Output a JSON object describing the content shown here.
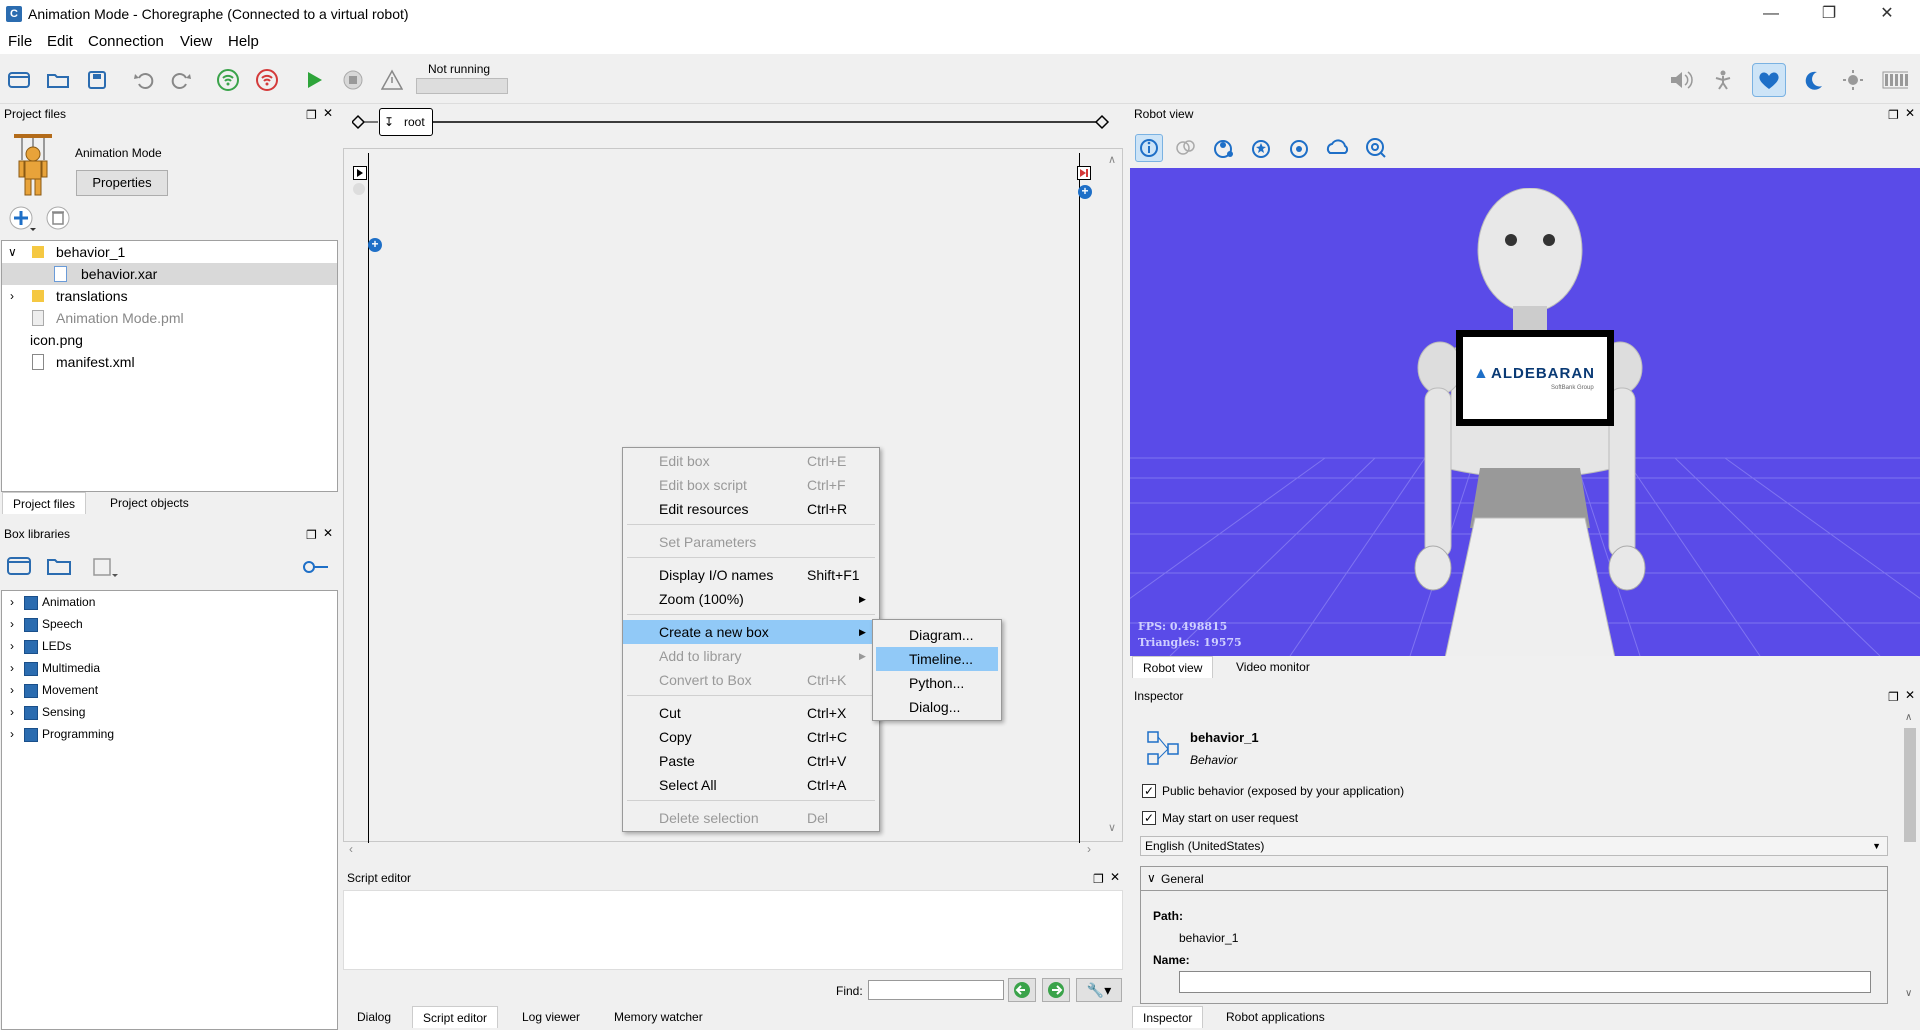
{
  "window": {
    "title": "Animation Mode - Choregraphe (Connected to a virtual robot)",
    "app_icon": "C"
  },
  "menu": [
    "File",
    "Edit",
    "Connection",
    "View",
    "Help"
  ],
  "toolbar": {
    "status": "Not running"
  },
  "project_files": {
    "title": "Project files",
    "project_name": "Animation Mode",
    "properties_label": "Properties",
    "tree": [
      {
        "label": "behavior_1",
        "type": "folder",
        "expanded": true,
        "indent": 0
      },
      {
        "label": "behavior.xar",
        "type": "file",
        "selected": true,
        "indent": 1
      },
      {
        "label": "translations",
        "type": "folder",
        "expanded": false,
        "indent": 0
      },
      {
        "label": "Animation Mode.pml",
        "type": "pml",
        "dim": true,
        "indent": 0
      },
      {
        "label": "icon.png",
        "type": "plain",
        "indent": 0
      },
      {
        "label": "manifest.xml",
        "type": "file",
        "indent": 0
      }
    ],
    "tabs": [
      "Project files",
      "Project objects"
    ]
  },
  "box_libraries": {
    "title": "Box libraries",
    "items": [
      "Animation",
      "Speech",
      "LEDs",
      "Multimedia",
      "Movement",
      "Sensing",
      "Programming"
    ]
  },
  "flow": {
    "breadcrumb": "root"
  },
  "context_menu": {
    "items": [
      {
        "label": "Edit box",
        "shortcut": "Ctrl+E",
        "disabled": true
      },
      {
        "label": "Edit box script",
        "shortcut": "Ctrl+F",
        "disabled": true
      },
      {
        "label": "Edit resources",
        "shortcut": "Ctrl+R",
        "disabled": false
      },
      {
        "label": "Set Parameters",
        "shortcut": "",
        "disabled": true
      },
      {
        "label": "Display I/O names",
        "shortcut": "Shift+F1",
        "disabled": false
      },
      {
        "label": "Zoom (100%)",
        "shortcut": "",
        "disabled": false,
        "submenu": true
      },
      {
        "label": "Create a new box",
        "shortcut": "",
        "disabled": false,
        "submenu": true,
        "highlighted": true
      },
      {
        "label": "Add to library",
        "shortcut": "",
        "disabled": true,
        "submenu": true
      },
      {
        "label": "Convert to Box",
        "shortcut": "Ctrl+K",
        "disabled": true
      },
      {
        "label": "Cut",
        "shortcut": "Ctrl+X",
        "disabled": false
      },
      {
        "label": "Copy",
        "shortcut": "Ctrl+C",
        "disabled": false
      },
      {
        "label": "Paste",
        "shortcut": "Ctrl+V",
        "disabled": false
      },
      {
        "label": "Select All",
        "shortcut": "Ctrl+A",
        "disabled": false
      },
      {
        "label": "Delete selection",
        "shortcut": "Del",
        "disabled": true
      }
    ],
    "submenu": [
      "Diagram...",
      "Timeline...",
      "Python...",
      "Dialog..."
    ]
  },
  "script_editor": {
    "title": "Script editor",
    "find_label": "Find:",
    "find_value": ""
  },
  "bottom_tabs": [
    "Dialog",
    "Script editor",
    "Log viewer",
    "Memory watcher"
  ],
  "robot_view": {
    "title": "Robot view",
    "fps": "FPS: 0.498815",
    "triangles": "Triangles: 19575",
    "tablet_logo": "ALDEBARAN",
    "tablet_sub": "SoftBank Group",
    "tabs": [
      "Robot view",
      "Video monitor"
    ],
    "bg_color": "#5a4be8"
  },
  "inspector": {
    "title": "Inspector",
    "name": "behavior_1",
    "type": "Behavior",
    "public_label": "Public behavior (exposed by your application)",
    "public_checked": true,
    "user_request_label": "May start on user request",
    "user_request_checked": true,
    "language": "English (UnitedStates)",
    "section": "General",
    "path_label": "Path:",
    "path_value": "behavior_1",
    "name_label": "Name:",
    "name_value": "",
    "tabs": [
      "Inspector",
      "Robot applications"
    ]
  }
}
